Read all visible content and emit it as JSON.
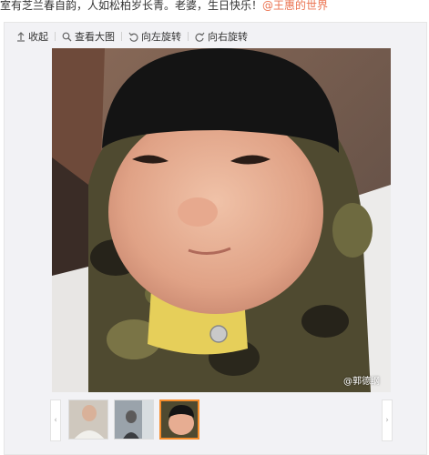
{
  "post": {
    "caption_text": "室有芝兰春自韵，人如松柏岁长青。老婆，生日快乐！",
    "mention": "@王惠的世界"
  },
  "toolbar": {
    "collapse_label": "收起",
    "view_large_label": "查看大图",
    "rotate_left_label": "向左旋转",
    "rotate_right_label": "向右旋转"
  },
  "photo": {
    "watermark": "@郭德纲"
  },
  "thumbnails": {
    "count": 3,
    "active_index": 3,
    "prev_arrow": "‹",
    "next_arrow": "›"
  },
  "colors": {
    "accent": "#eb7350",
    "active_thumb_border": "#f58c2b",
    "panel_bg": "#f2f2f5"
  }
}
